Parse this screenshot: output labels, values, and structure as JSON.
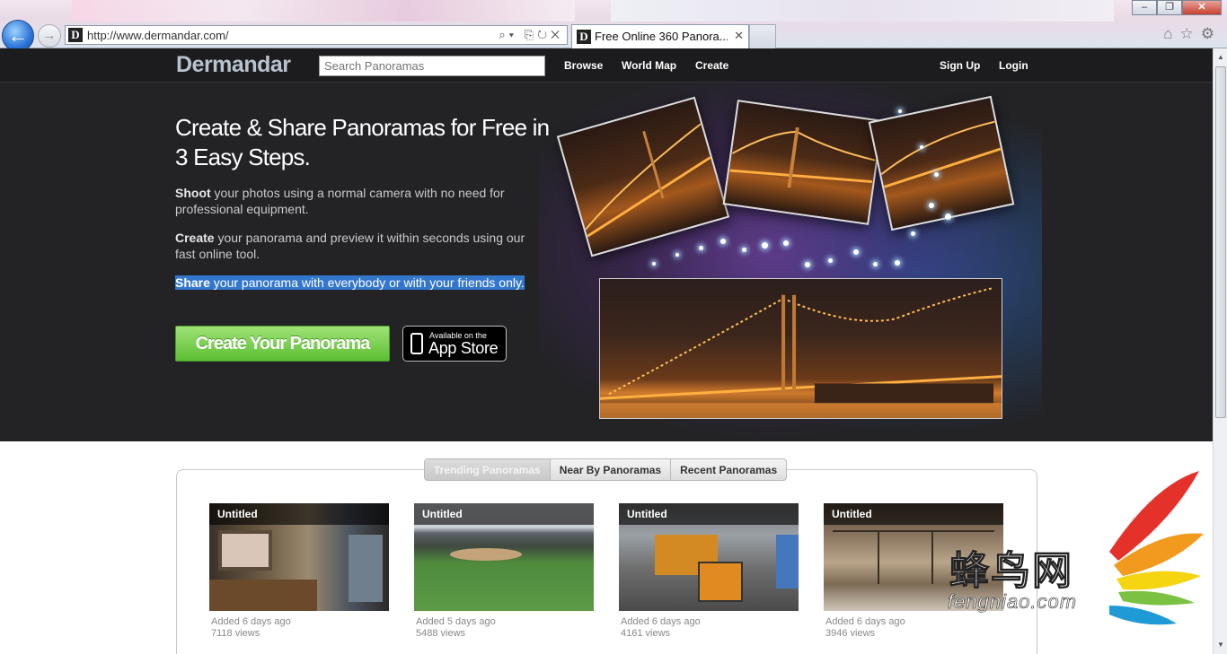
{
  "browser": {
    "url": "http://www.dermandar.com/",
    "tab_title": "Free Online 360 Panora...",
    "tab_close": "✕",
    "favicon_letter": "D",
    "window_buttons": [
      "–",
      "❐",
      "✕"
    ]
  },
  "site": {
    "logo": "Dermandar",
    "search_placeholder": "Search Panoramas",
    "nav": {
      "browse": "Browse",
      "world_map": "World Map",
      "create": "Create",
      "sign_up": "Sign Up",
      "login": "Login"
    }
  },
  "hero": {
    "title": "Create & Share Panoramas for Free in 3 Easy Steps.",
    "steps": [
      {
        "bold": "Shoot",
        "text": " your photos using a normal camera with no need for professional equipment."
      },
      {
        "bold": "Create",
        "text": " your panorama and preview it within seconds using our fast online tool."
      },
      {
        "bold": "Share",
        "text": " your panorama with everybody or with your friends only."
      }
    ],
    "cta_label": "Create Your Panorama",
    "appstore_small": "Available on the",
    "appstore_big": "App Store"
  },
  "panoramas": {
    "tabs": [
      "Trending Panoramas",
      "Near By Panoramas",
      "Recent Panoramas"
    ],
    "active_tab": "Trending Panoramas",
    "items": [
      {
        "title": "Untitled",
        "added": "Added 6 days ago",
        "views": "7118 views"
      },
      {
        "title": "Untitled",
        "added": "Added 5 days ago",
        "views": "5488 views"
      },
      {
        "title": "Untitled",
        "added": "Added 6 days ago",
        "views": "4161 views"
      },
      {
        "title": "Untitled",
        "added": "Added 6 days ago",
        "views": "3946 views"
      }
    ]
  },
  "watermark": {
    "cn": "蜂鸟网",
    "latin": "fengniao.com"
  },
  "colors": {
    "cta_green": "#6ccc3f",
    "hero_bg": "#232326",
    "nav_bg": "#1c1c1e",
    "highlight": "#3377cc"
  }
}
